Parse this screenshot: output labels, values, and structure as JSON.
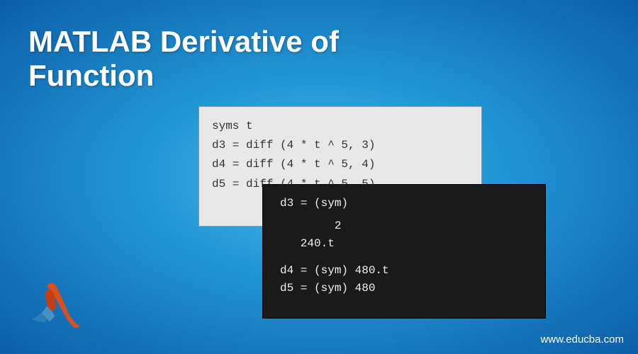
{
  "title": "MATLAB Derivative of\nFunction",
  "code_light": {
    "line1": "syms t",
    "line2": "d3 = diff (4 * t ^ 5, 3)",
    "line3": "d4 = diff (4 * t ^ 5, 4)",
    "line4": "d5 = diff (4 * t ^ 5, 5)"
  },
  "code_dark": {
    "line1": "d3 = (sym)",
    "line2": "        2",
    "line3": "   240.t",
    "line4": "d4 = (sym) 480.t",
    "line5": "d5 = (sym) 480"
  },
  "url": "www.educba.com",
  "logo": {
    "name": "matlab-logo"
  }
}
